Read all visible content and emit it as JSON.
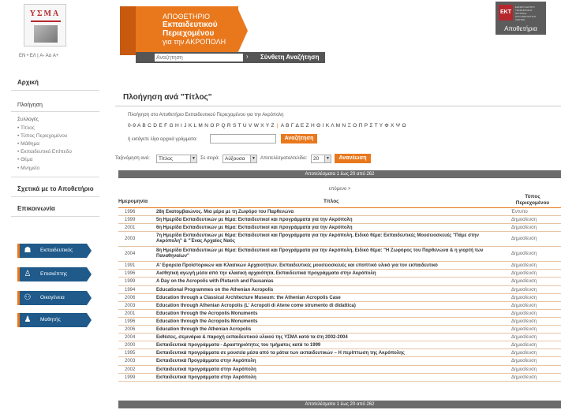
{
  "header": {
    "logo_text": "ΥΣΜΑ",
    "banner_line1": "ΑΠΟΘΕΤΗΡΙΟ",
    "banner_line2": "Εκπαιδευτικού",
    "banner_line3": "Περιεχομένου",
    "banner_line4": "για την ΑΚΡΟΠΟΛΗ",
    "search_placeholder": "Αναζήτηση",
    "search_arrow": "›",
    "advanced_search": "Σύνθετη Αναζήτηση",
    "ekt_mark": "ΕΚΤ",
    "ekt_small": "ΕΘΝΙΚΟ ΚΕΝΤΡΟ ΤΕΚΜΗΡΙΩΣΗΣ NATIONAL DOCUMENTATION CENTRE",
    "ekt_label": "Αποθετήρια",
    "lang_bar": "EN • ΕΛ  |  A- Aα A+"
  },
  "sidebar": {
    "home": "Αρχική",
    "browse": "Πλοήγηση",
    "collections_title": "Συλλογές",
    "collections": [
      "• Τίτλος",
      "• Τύπος Περιεχομένου",
      "• Μάθημα",
      "• Εκπαιδευτικό Επίπεδο",
      "• Θέμα",
      "• Μνημείο"
    ],
    "about": "Σχετικά με το Αποθετήριο",
    "contact": "Επικοινωνία",
    "audiences": [
      "Εκπαιδευτικός",
      "Επισκέπτης",
      "Οικογένεια",
      "Μαθητής"
    ]
  },
  "main": {
    "title": "Πλοήγηση ανά \"Τίτλος\"",
    "intro": "Πλοήγηση στο Αποθετήριο Εκπαιδευτικού Περιεχομένου για την Ακρόπολη",
    "latin_letters": "0-9 A B C D E F G H I J K L M N O P Q R S T U V W X Y Z",
    "greek_letters": "Α Β Γ Δ Ε Ζ Η Θ Ι Κ Λ Μ Ν Ξ Ο Π Ρ Σ Τ Υ Φ Χ Ψ Ω",
    "type_label": "ή εισάγετε λίγα αρχικά γράμματα:",
    "search_button": "Αναζήτηση",
    "sort_by_label": "Ταξινόμηση ανά:",
    "sort_by_value": "Τίτλος",
    "order_label": "Σε σειρά:",
    "order_value": "Αύξουσα",
    "per_page_label": "Αποτελέσματα/σελίδα:",
    "per_page_value": "20",
    "refresh_button": "Ανανέωση",
    "results_text": "Αποτελέσματα 1 έως 20 από 262",
    "next_link": "επόμενο >",
    "col_date": "Ημερομηνία",
    "col_title": "Τίτλος",
    "col_type_1": "Τύπος",
    "col_type_2": "Περιεχομένου"
  },
  "rows": [
    {
      "date": "1996",
      "title": "28η Εκατομβαιώνος. Μια μέρα με τη Ζωφόρο του Παρθενώνα",
      "type": "Έντυπο",
      "lines": 1
    },
    {
      "date": "1999",
      "title": "5η Ημερίδα Εκπαιδευτικών με θέμα: Εκπαιδευτικοί και προγράμματα για την Ακρόπολη",
      "type": "Δημοσίευση",
      "lines": 1
    },
    {
      "date": "2001",
      "title": "6η Ημερίδα Εκπαιδευτικών με θέμα: Εκπαιδευτικοί και προγράμματα για την Ακρόπολη",
      "type": "Δημοσίευση",
      "lines": 1
    },
    {
      "date": "2003",
      "title": "7η Ημερίδα Εκπαιδευτικών με θέμα: Εκπαιδευτικοί και Προγράμματα για την Ακρόπολη, Ειδικό θέμα: Εκπαιδευτικές Μουσειοσκευές \"Πάμε στην Ακρόπολη\" & \"Ένας Αρχαίος Ναός",
      "type": "Δημοσίευση",
      "lines": 2
    },
    {
      "date": "2004",
      "title": "8η Ημερίδα Εκπαιδευτικών με θέμα: Εκπαιδευτικοί και Προγράμματα για την Ακρόπολη, Ειδικό θέμα: \"Η Ζωφόρος του Παρθενώνα & η γιορτή των Παναθηναίων\"",
      "type": "Δημοσίευση",
      "lines": 2
    },
    {
      "date": "1991",
      "title": "Α' Εφορεία Προϊστορικών και Κλασικών Αρχαιοτήτων. Εκπαιδευτικές μουσειοσκευές και εποπτικό υλικό για τον εκπαιδευτικό",
      "type": "Δημοσίευση",
      "lines": 1
    },
    {
      "date": "1996",
      "title": "Αισθητική αγωγή μέσα από την κλασική αρχαιότητα. Εκπαιδευτικά προγράμματα στην Ακρόπολη",
      "type": "Δημοσίευση",
      "lines": 1
    },
    {
      "date": "1999",
      "title": "A Day on the Acropolis with Plutarch and Pausanias",
      "type": "Δημοσίευση",
      "lines": 1
    },
    {
      "date": "1994",
      "title": "Educational Programmes on the Athenian Acropolis",
      "type": "Δημοσίευση",
      "lines": 1
    },
    {
      "date": "2006",
      "title": "Education through a Classical Architecture Museum: the Athenian Acropolis Case",
      "type": "Δημοσίευση",
      "lines": 1
    },
    {
      "date": "2003",
      "title": "Education through Athenian Acropolis (L' Acropoli di Atene come strumento di didattica)",
      "type": "Δημοσίευση",
      "lines": 1
    },
    {
      "date": "2001",
      "title": "Education through the Acropolis Monuments",
      "type": "Δημοσίευση",
      "lines": 1
    },
    {
      "date": "1996",
      "title": "Education through the Acropolis Monuments",
      "type": "Δημοσίευση",
      "lines": 1
    },
    {
      "date": "2006",
      "title": "Education through the Athenian Acropolis",
      "type": "Δημοσίευση",
      "lines": 1
    },
    {
      "date": "2004",
      "title": "Εκθέσεις, σεμινάρια & παροχή εκπαιδευτικού υλικού της ΥΣΜΑ κατά τα έτη 2002-2004",
      "type": "Δημοσίευση",
      "lines": 1
    },
    {
      "date": "2000",
      "title": "Εκπαιδευτικά προγράμματα - Δραστηριότητες του τμήματος κατά το 1999",
      "type": "Δημοσίευση",
      "lines": 1
    },
    {
      "date": "1995",
      "title": "Εκπαιδευτικά προγράμματα σε μουσεία μέσα από τα μάτια των εκπαιδευτικών – Η περίπτωση της Ακρόπολης",
      "type": "Δημοσίευση",
      "lines": 1
    },
    {
      "date": "2003",
      "title": "Εκπαιδευτικά Προγράμματα στην Ακρόπολη",
      "type": "Δημοσίευση",
      "lines": 1
    },
    {
      "date": "2002",
      "title": "Εκπαιδευτικά προγράμματα στην Ακρόπολη",
      "type": "Δημοσίευση",
      "lines": 1
    },
    {
      "date": "1999",
      "title": "Εκπαιδευτικά προγράμματα στην Ακρόπολη",
      "type": "Δημοσίευση",
      "lines": 1
    }
  ]
}
